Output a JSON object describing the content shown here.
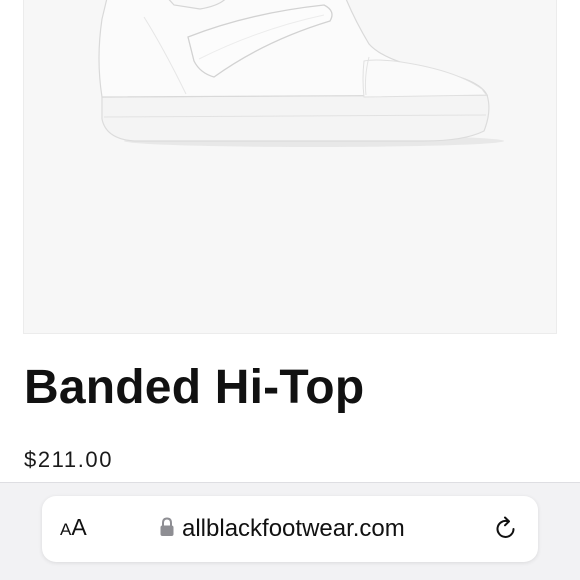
{
  "product": {
    "title": "Banded Hi-Top",
    "price": "$211.00",
    "image_icon": "white-leather-hi-top-sneaker"
  },
  "browser": {
    "text_size_small": "A",
    "text_size_large": "A",
    "url": "allblackfootwear.com",
    "lock_icon": "lock-icon",
    "reload_icon": "reload-icon"
  },
  "colors": {
    "image_background": "#f7f7f7",
    "title_text": "#111111",
    "toolbar_background": "#f2f2f4",
    "address_pill": "#ffffff"
  }
}
